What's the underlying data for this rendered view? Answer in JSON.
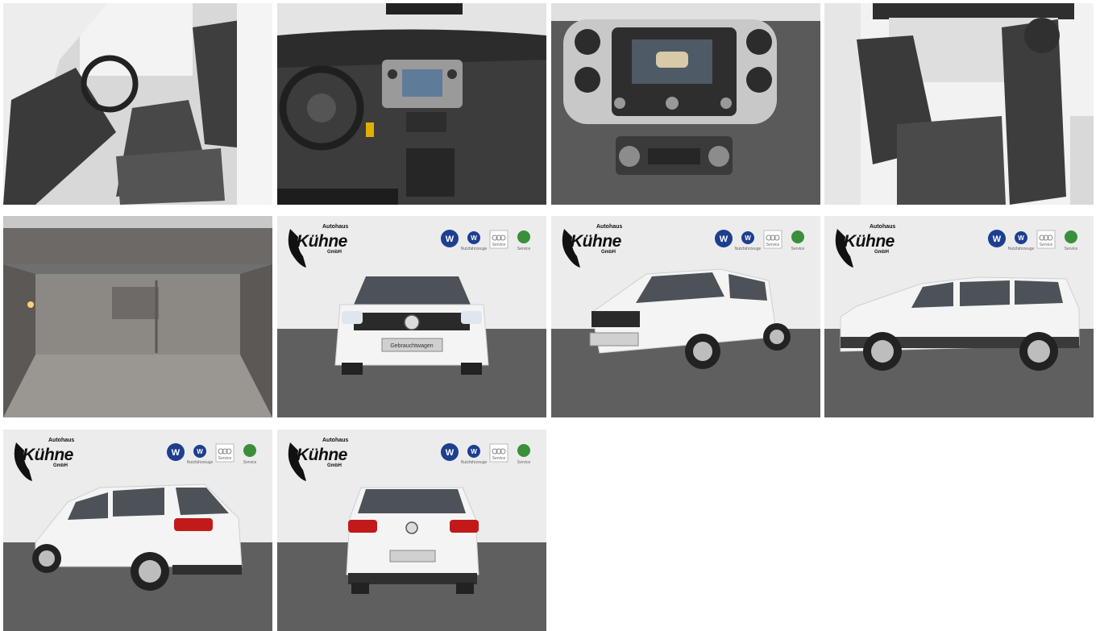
{
  "gallery": {
    "dealer": {
      "name": "Kühne",
      "prefix": "Autohaus",
      "suffix": "GmbH"
    },
    "plate_text": "Gebrauchtwagen",
    "brand_captions": {
      "vw_nutz": "Nutzfahrzeuge",
      "audi": "Service",
      "skoda": "Service"
    },
    "photos": [
      {
        "subject": "front-seats"
      },
      {
        "subject": "dashboard"
      },
      {
        "subject": "center-console"
      },
      {
        "subject": "rear-seats"
      },
      {
        "subject": "trunk"
      },
      {
        "subject": "front-view"
      },
      {
        "subject": "front-left-view"
      },
      {
        "subject": "side-view"
      },
      {
        "subject": "rear-left-view"
      },
      {
        "subject": "rear-view"
      }
    ]
  },
  "colors": {
    "body_white": "#f4f4f4",
    "ground": "#5f5f5f",
    "wall": "#ececec",
    "vw_blue": "#1d3f8f"
  }
}
